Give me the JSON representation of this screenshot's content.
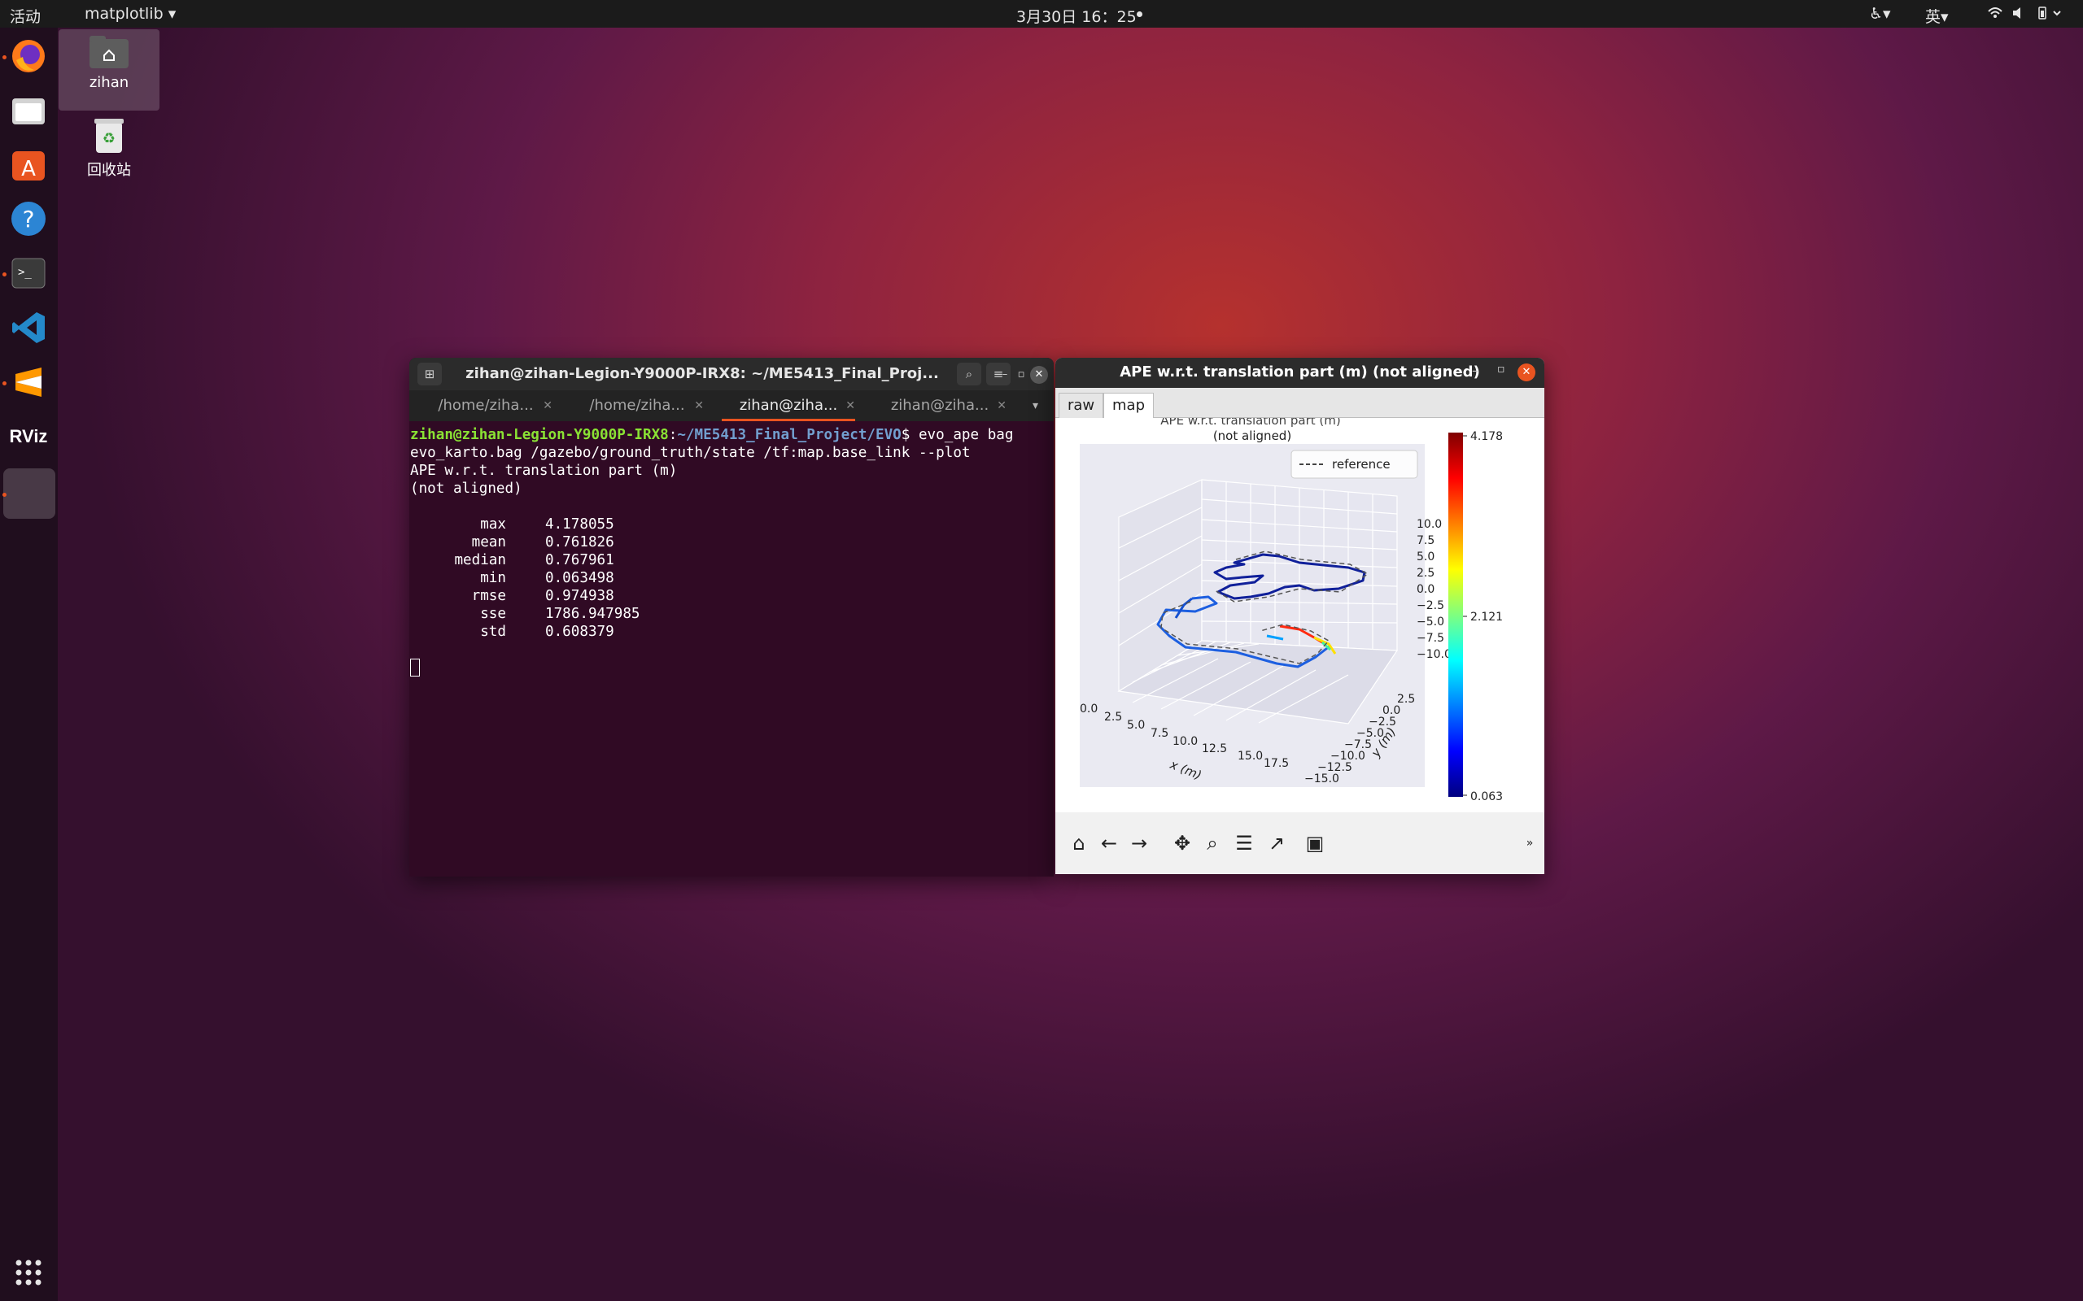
{
  "topbar": {
    "activities": "活动",
    "app_menu": "matplotlib",
    "clock": "3月30日 16：25",
    "input_method": "英"
  },
  "desktop": {
    "home_label": "zihan",
    "trash_label": "回收站"
  },
  "dock": {
    "apps": [
      "firefox-icon",
      "files-icon",
      "software-icon",
      "help-icon",
      "terminal-icon",
      "vscode-icon",
      "sublime-icon",
      "rviz-icon",
      "active-window-icon"
    ],
    "rviz_text": "RViz"
  },
  "terminal": {
    "title": "zihan@zihan-Legion-Y9000P-IRX8: ~/ME5413_Final_Proj...",
    "tabs": [
      "/home/ziha...",
      "/home/ziha...",
      "zihan@ziha...",
      "zihan@ziha..."
    ],
    "active_tab": 2,
    "prompt_user": "zihan@zihan-Legion-Y9000P-IRX8",
    "prompt_path": "~/ME5413_Final_Project/EVO",
    "command_line1": "$ evo_ape bag",
    "command_line2": "evo_karto.bag /gazebo/ground_truth/state /tf:map.base_link --plot",
    "output_title": "APE w.r.t. translation part (m)",
    "output_subtitle": "(not aligned)",
    "stats": [
      {
        "key": "max",
        "value": "4.178055"
      },
      {
        "key": "mean",
        "value": "0.761826"
      },
      {
        "key": "median",
        "value": "0.767961"
      },
      {
        "key": "min",
        "value": "0.063498"
      },
      {
        "key": "rmse",
        "value": "0.974938"
      },
      {
        "key": "sse",
        "value": "1786.947985"
      },
      {
        "key": "std",
        "value": "0.608379"
      }
    ]
  },
  "plot_window": {
    "title": "APE w.r.t. translation part (m) (not aligned)",
    "tabs": [
      "raw",
      "map"
    ],
    "active_tab": "map",
    "figure_title_line1": "APE w.r.t. translation part (m)",
    "figure_title_line2": "(not aligned)",
    "legend_label": "reference",
    "x_label": "x (m)",
    "y_label": "y (m)",
    "x_ticks": [
      "0.0",
      "2.5",
      "5.0",
      "7.5",
      "10.0",
      "12.5",
      "15.0",
      "17.5"
    ],
    "y_ticks": [
      "2.5",
      "0.0",
      "−2.5",
      "−5.0",
      "−7.5",
      "−10.0",
      "−12.5",
      "−15.0"
    ],
    "z_ticks": [
      "10.0",
      "7.5",
      "5.0",
      "2.5",
      "0.0",
      "−2.5",
      "−5.0",
      "−7.5",
      "−10.0"
    ],
    "colorbar_ticks": [
      "4.178",
      "2.121",
      "0.063"
    ],
    "toolbar_icons": [
      "home-icon",
      "back-icon",
      "forward-icon",
      "pan-icon",
      "zoom-icon",
      "configure-icon",
      "edit-axis-icon",
      "save-icon"
    ]
  }
}
